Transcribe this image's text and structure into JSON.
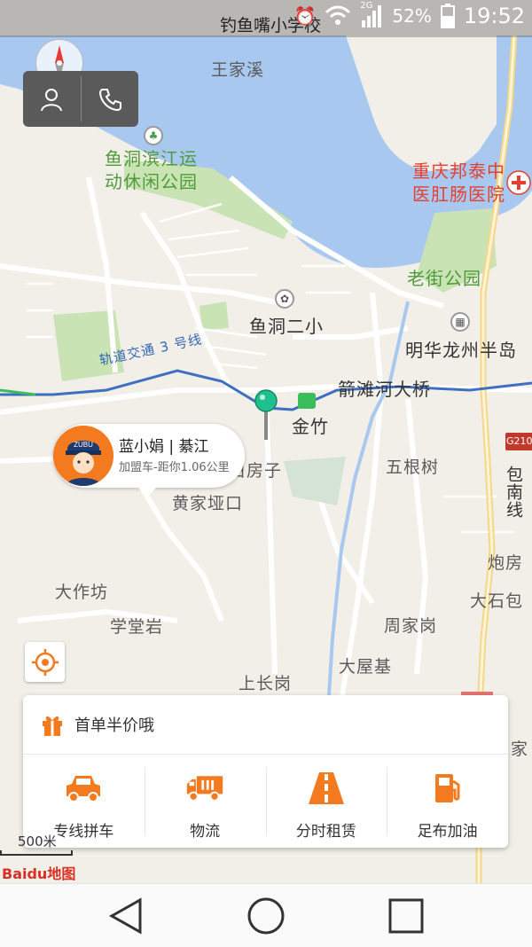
{
  "status_bar": {
    "location_title": "钓鱼嘴小学校",
    "network": "2G",
    "battery": "52%",
    "time": "19:52"
  },
  "map": {
    "labels": {
      "wangjiaxi": "王家溪",
      "yudong_park": "鱼洞滨江运\n动休闲公园",
      "hospital": "重庆邦泰中\n医肛肠医院",
      "laojie_park": "老街公园",
      "yudong_school": "鱼洞二小",
      "minghua": "明华龙州半岛",
      "metro_line": "轨道交通 3 号线",
      "bridge": "箭滩河大桥",
      "jinzhu": "金竹",
      "baifangzi": "白房子",
      "wugenshu": "五根树",
      "huangjiayakou": "黄家垭口",
      "baonan_line": "包南线",
      "g210": "G210",
      "paofang": "炮房",
      "dashibao": "大石包",
      "dazuofang": "大作坊",
      "xuetangyan": "学堂岩",
      "zhoujiagang": "周家岗",
      "dawuji": "大屋基",
      "shangchanggang": "上长岗",
      "jia": "家"
    },
    "marker_icon": "map-pin-icon"
  },
  "driver_bubble": {
    "name": "蓝小娟 | 綦江",
    "distance": "加盟车-距你1.06公里",
    "badge": "ZUBU"
  },
  "promo": {
    "text": "首单半价哦",
    "icon": "gift-icon"
  },
  "services": [
    {
      "label": "专线拼车",
      "icon": "car-icon"
    },
    {
      "label": "物流",
      "icon": "truck-icon"
    },
    {
      "label": "分时租赁",
      "icon": "road-icon"
    },
    {
      "label": "足布加油",
      "icon": "fuel-pump-icon"
    }
  ],
  "map_footer": {
    "scale": "500米",
    "logo": "Baidu地图"
  },
  "colors": {
    "accent": "#f47a20",
    "water": "#a9c8f0",
    "park": "#c9e3b4"
  }
}
